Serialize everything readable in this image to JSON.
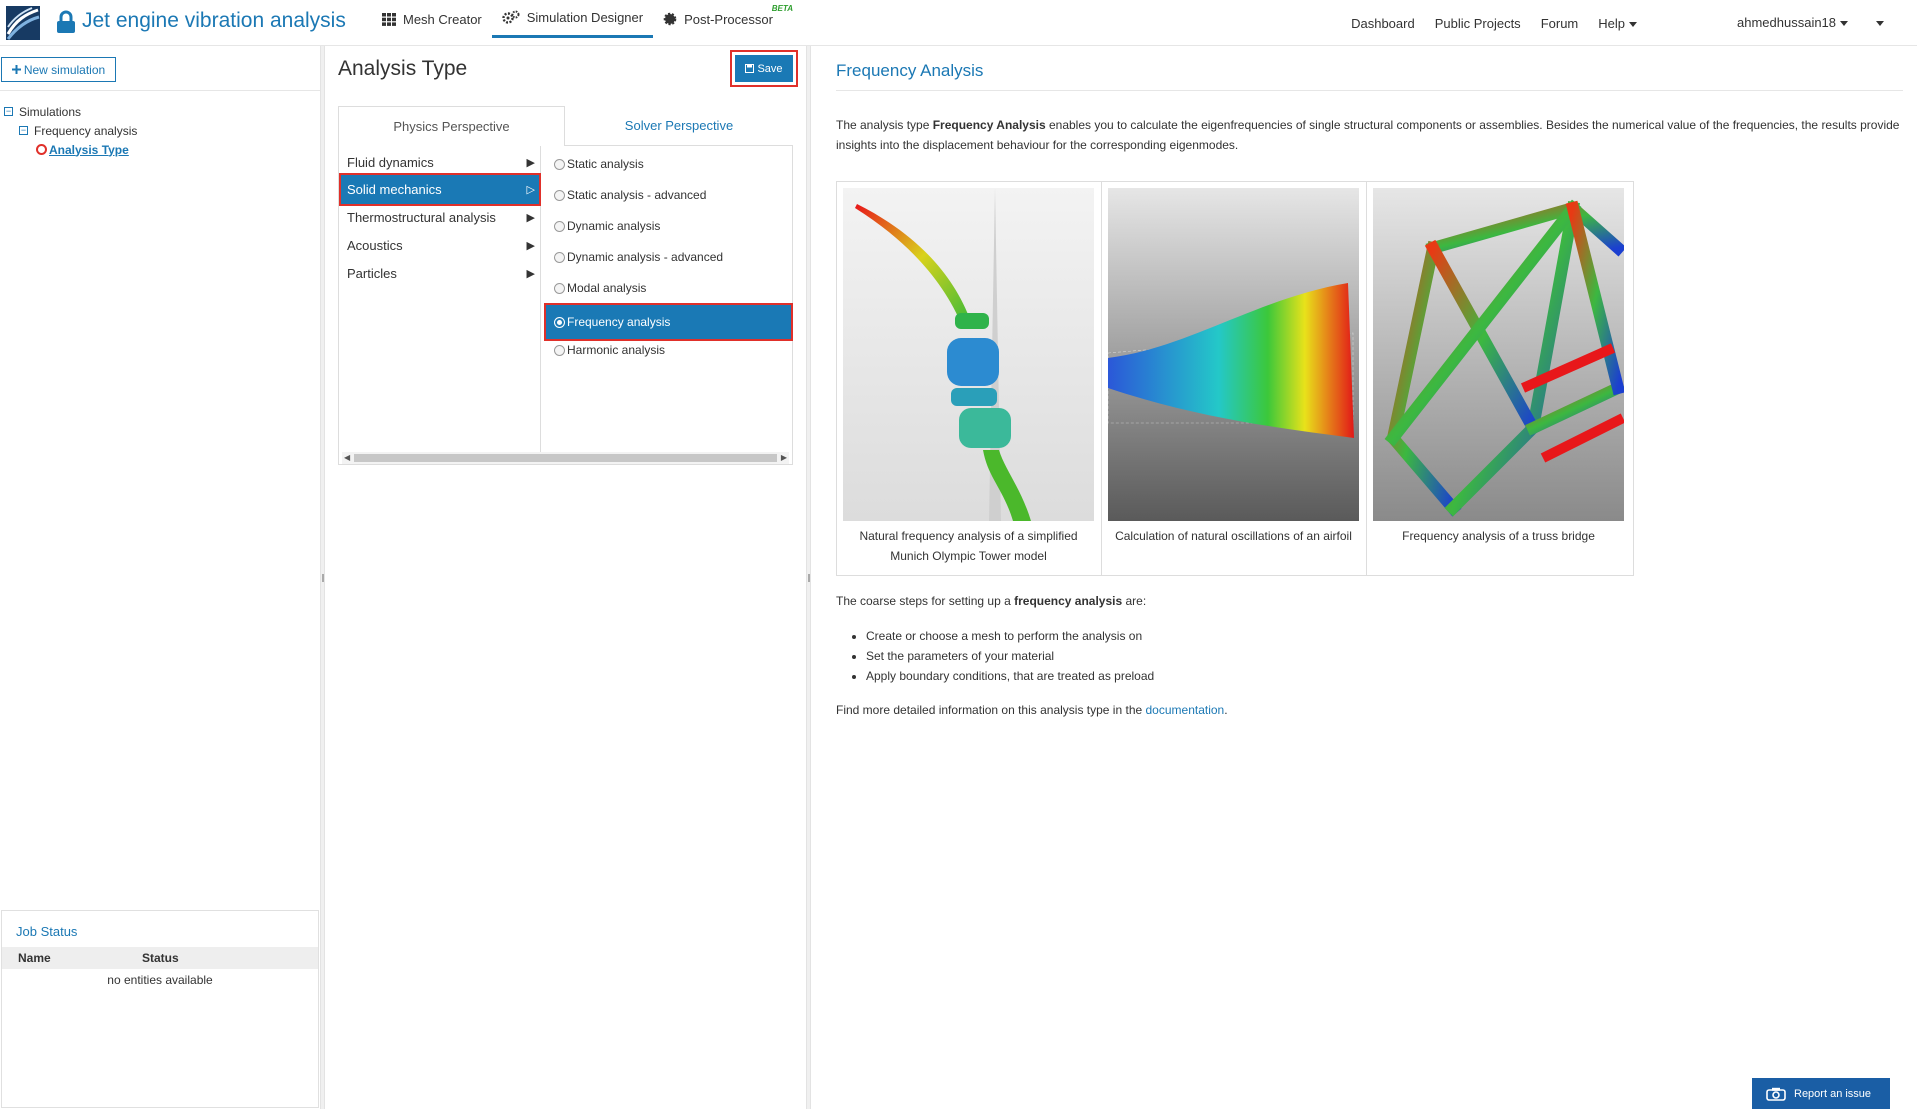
{
  "header": {
    "app_title": "Jet engine vibration analysis",
    "tools": [
      {
        "label": "Mesh Creator",
        "icon": "grid-icon"
      },
      {
        "label": "Simulation Designer",
        "icon": "gears-icon",
        "active": true
      },
      {
        "label": "Post-Processor",
        "icon": "gear-icon",
        "badge": "BETA"
      }
    ],
    "nav": {
      "dashboard": "Dashboard",
      "public_projects": "Public Projects",
      "forum": "Forum",
      "help": "Help"
    },
    "username": "ahmedhussain18"
  },
  "sidebar": {
    "new_simulation_label": "New simulation",
    "tree": {
      "root": "Simulations",
      "simulation": "Frequency analysis",
      "node": "Analysis Type"
    },
    "job_status": {
      "title": "Job Status",
      "columns": [
        "Name",
        "Status"
      ],
      "empty": "no entities available"
    }
  },
  "analysis": {
    "title": "Analysis Type",
    "save_label": "Save",
    "tabs": [
      "Physics Perspective",
      "Solver Perspective"
    ],
    "categories": [
      {
        "label": "Fluid dynamics",
        "arrow": "▶"
      },
      {
        "label": "Solid mechanics",
        "arrow": "▷",
        "selected": true
      },
      {
        "label": "Thermostructural analysis",
        "arrow": "▶"
      },
      {
        "label": "Acoustics",
        "arrow": "▶"
      },
      {
        "label": "Particles",
        "arrow": "▶"
      }
    ],
    "types": [
      {
        "label": "Static analysis"
      },
      {
        "label": "Static analysis - advanced"
      },
      {
        "label": "Dynamic analysis"
      },
      {
        "label": "Dynamic analysis - advanced"
      },
      {
        "label": "Modal analysis"
      },
      {
        "label": "Frequency analysis",
        "selected": true
      },
      {
        "label": "Harmonic analysis"
      }
    ]
  },
  "doc": {
    "title": "Frequency Analysis",
    "intro_pre": "The analysis type ",
    "intro_bold": "Frequency Analysis",
    "intro_post": " enables you to calculate the eigenfrequencies of single structural components or assemblies. Besides the numerical value of the frequencies, the results provide insights into the displacement behaviour for the corresponding eigenmodes.",
    "gallery": [
      {
        "caption": "Natural frequency analysis of a simplified Munich Olympic Tower model"
      },
      {
        "caption": "Calculation of natural oscillations of an airfoil"
      },
      {
        "caption": "Frequency analysis of a truss bridge"
      }
    ],
    "steps_pre": "The coarse steps for setting up a ",
    "steps_bold": "frequency analysis",
    "steps_post": " are:",
    "steps": [
      "Create or choose a mesh to perform the analysis on",
      "Set the parameters of your material",
      "Apply boundary conditions, that are treated as preload"
    ],
    "more_pre": "Find more detailed information on this analysis type in the ",
    "more_link": "documentation",
    "more_post": "."
  },
  "report_issue_label": "Report an issue",
  "colors": {
    "accent": "#1b78b4",
    "selected_bg": "#1a79b5",
    "highlight_outline": "#e0302a",
    "report_button": "#1a5ea5"
  }
}
